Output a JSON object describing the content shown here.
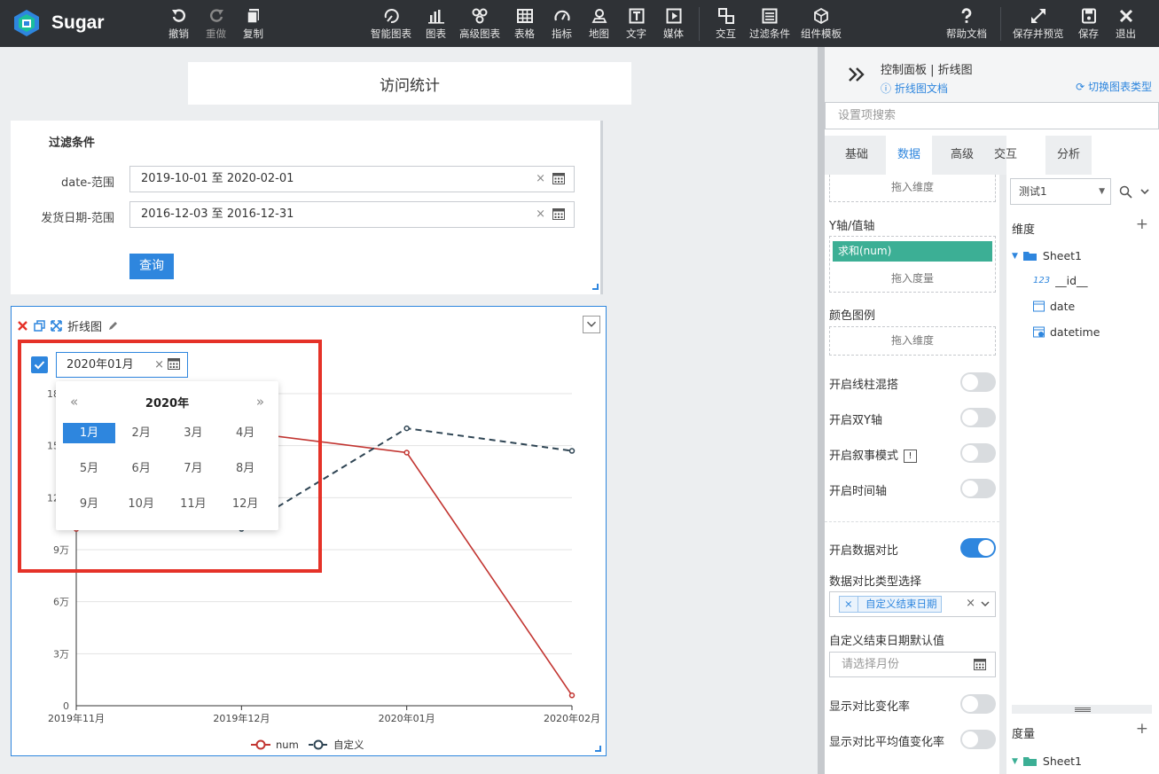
{
  "topbar": {
    "logo_text": "Sugar",
    "buttons": {
      "undo": "撤销",
      "redo": "重做",
      "copy": "复制",
      "smart_chart": "智能图表",
      "chart": "图表",
      "adv_chart": "高级图表",
      "table": "表格",
      "indicator": "指标",
      "map": "地图",
      "text": "文字",
      "media": "媒体",
      "interact": "交互",
      "filter": "过滤条件",
      "template": "组件模板",
      "help": "帮助文档",
      "save_preview": "保存并预览",
      "save": "保存",
      "exit": "退出"
    }
  },
  "canvas": {
    "page_title": "访问统计",
    "filter": {
      "title": "过滤条件",
      "rows": [
        {
          "label": "date-范围",
          "value": "2019-10-01 至 2020-02-01"
        },
        {
          "label": "发货日期-范围",
          "value": "2016-12-03 至 2016-12-31"
        }
      ],
      "query_label": "查询"
    },
    "chart_card": {
      "title": "折线图",
      "date_value": "2020年01月",
      "picker": {
        "year": "2020年",
        "months": [
          "1月",
          "2月",
          "3月",
          "4月",
          "5月",
          "6月",
          "7月",
          "8月",
          "9月",
          "10月",
          "11月",
          "12月"
        ],
        "selected_index": 0
      }
    }
  },
  "chart_data": {
    "type": "line",
    "categories": [
      "2019年11月",
      "2019年12月",
      "2020年01月",
      "2020年02月"
    ],
    "y_ticks": [
      "0",
      "3万",
      "6万",
      "9万",
      "12万",
      "15万",
      "18万"
    ],
    "ylim": [
      0,
      180000
    ],
    "series": [
      {
        "name": "num",
        "color": "#c23531",
        "style": "solid",
        "values": [
          102000,
          158000,
          146000,
          6000
        ]
      },
      {
        "name": "自定义",
        "color": "#2f4554",
        "style": "dashed",
        "values": [
          null,
          102000,
          160000,
          147000
        ]
      }
    ],
    "legend_position": "bottom"
  },
  "right_panel": {
    "title": "控制面板 | 折线图",
    "doc_link": "折线图文档",
    "switch_label": "切换图表类型",
    "search_placeholder": "设置项搜索",
    "tabs": [
      "基础",
      "数据",
      "高级",
      "交互",
      "分析"
    ],
    "active_tab": "数据",
    "settings": {
      "drop_dimension": "拖入维度",
      "y_axis_label": "Y轴/值轴",
      "measure_tag": "求和(num)",
      "drop_measure": "拖入度量",
      "color_legend_label": "颜色图例",
      "drop_dimension2": "拖入维度",
      "toggles": [
        {
          "label": "开启线柱混搭",
          "on": false
        },
        {
          "label": "开启双Y轴",
          "on": false
        },
        {
          "label": "开启叙事模式",
          "on": false
        },
        {
          "label": "开启时间轴",
          "on": false
        }
      ],
      "compare_label": "开启数据对比",
      "compare_on": true,
      "compare_type_label": "数据对比类型选择",
      "compare_type_tag": "自定义结束日期",
      "default_end_label": "自定义结束日期默认值",
      "default_end_placeholder": "请选择月份",
      "show_rate_label": "显示对比变化率",
      "show_avg_rate_label": "显示对比平均值变化率"
    },
    "fields": {
      "dataset": "测试1",
      "dimension_title": "维度",
      "sheet_name": "Sheet1",
      "dimension_fields": [
        {
          "icon": "number-icon",
          "name": "__id__"
        },
        {
          "icon": "date-icon",
          "name": "date"
        },
        {
          "icon": "datetime-icon",
          "name": "datetime"
        }
      ],
      "measure_title": "度量",
      "measure_sheet": "Sheet1"
    }
  },
  "colors": {
    "accent": "#2e86de",
    "topbar": "#2f3236",
    "tag_green": "#3caf95",
    "highlight_red": "#e53228"
  }
}
